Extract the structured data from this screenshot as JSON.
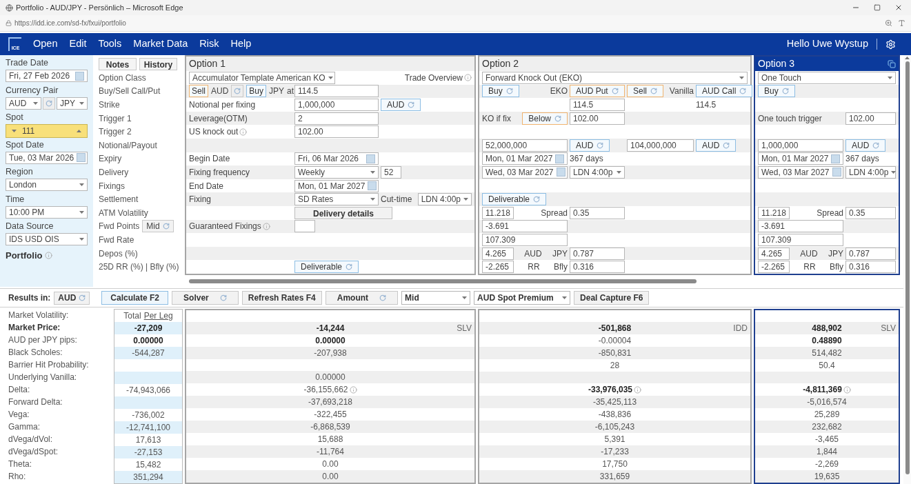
{
  "browser": {
    "title": "Portfolio - AUD/JPY - Persönlich – Microsoft Edge",
    "url": "https://idd.ice.com/sd-fx/fxui/portfolio"
  },
  "app": {
    "logo": "ICE",
    "menu": [
      "Open",
      "Edit",
      "Tools",
      "Market Data",
      "Risk",
      "Help"
    ],
    "greeting": "Hello Uwe Wystup"
  },
  "sidebar": {
    "fields": [
      {
        "label": "Trade Date",
        "kind": "date",
        "value": "Fri, 27 Feb 2026"
      },
      {
        "label": "Currency Pair",
        "kind": "pair",
        "base": "AUD",
        "quote": "JPY"
      },
      {
        "label": "Spot",
        "kind": "spot",
        "value": "111"
      },
      {
        "label": "Spot Date",
        "kind": "date",
        "value": "Tue, 03 Mar 2026"
      },
      {
        "label": "Region",
        "kind": "select",
        "value": "London"
      },
      {
        "label": "Time",
        "kind": "select",
        "value": "10:00 PM"
      },
      {
        "label": "Data Source",
        "kind": "select",
        "value": "IDS USD OIS"
      }
    ],
    "portfolio": "Portfolio"
  },
  "panel_buttons": [
    "Notes",
    "History"
  ],
  "row_labels": [
    {
      "text": "Option Class"
    },
    {
      "text": "Buy/Sell Call/Put"
    },
    {
      "text": "Strike"
    },
    {
      "text": "Trigger 1"
    },
    {
      "text": "Trigger 2"
    },
    {
      "text": "Notional/Payout"
    },
    {
      "text": "Expiry"
    },
    {
      "text": "Delivery"
    },
    {
      "text": "Fixings"
    },
    {
      "text": "Settlement"
    },
    {
      "text": "ATM Volatility"
    },
    {
      "text": "Fwd Points",
      "toggle": "Mid"
    },
    {
      "text": "Fwd Rate"
    },
    {
      "text": "Depos (%)"
    },
    {
      "text": "25D RR (%) | Bfly (%)"
    }
  ],
  "options": [
    {
      "title": "Option 1",
      "selected": false,
      "product": "Accumulator Template American KO",
      "overview": "Trade Overview",
      "rows": [
        {
          "left": [
            {
              "kind": "choice",
              "text": "Sell",
              "color": "#f0b36e"
            },
            {
              "kind": "text",
              "text": "AUD"
            },
            {
              "kind": "swap"
            },
            {
              "kind": "choice",
              "text": "Buy",
              "color": "#8cbde3"
            },
            {
              "kind": "text",
              "text": "JPY"
            },
            {
              "kind": "text",
              "text": "at"
            }
          ],
          "middle": [
            {
              "kind": "input",
              "text": "114.5"
            }
          ]
        },
        {
          "left": [
            {
              "kind": "text",
              "text": "Notional per fixing"
            }
          ],
          "middle": [
            {
              "kind": "input",
              "text": "1,000,000"
            }
          ],
          "right": [
            {
              "kind": "toggle",
              "text": "AUD",
              "color": "#8cbde3"
            }
          ]
        },
        {
          "left": [
            {
              "kind": "text",
              "text": "Leverage(OTM)"
            }
          ],
          "middle": [
            {
              "kind": "input",
              "text": "2"
            }
          ]
        },
        {
          "left": [
            {
              "kind": "text",
              "text": "US knock out",
              "info": true
            }
          ],
          "middle": [
            {
              "kind": "input",
              "text": "102.00"
            }
          ]
        },
        {},
        {
          "left": [
            {
              "kind": "text",
              "text": "Begin Date"
            }
          ],
          "middle": [
            {
              "kind": "date",
              "text": "Fri, 06 Mar 2026"
            }
          ]
        },
        {
          "left": [
            {
              "kind": "text",
              "text": "Fixing frequency"
            }
          ],
          "middle": [
            {
              "kind": "select",
              "text": "Weekly"
            }
          ],
          "right": [
            {
              "kind": "box",
              "text": "52"
            }
          ]
        },
        {
          "left": [
            {
              "kind": "text",
              "text": "End Date"
            }
          ],
          "middle": [
            {
              "kind": "date",
              "text": "Mon, 01 Mar 2027"
            }
          ]
        },
        {
          "left": [
            {
              "kind": "text",
              "text": "Fixing"
            }
          ],
          "middle": [
            {
              "kind": "select",
              "text": "SD Rates"
            }
          ],
          "right": [
            {
              "kind": "text",
              "text": "Cut-time"
            }
          ],
          "end": [
            {
              "kind": "select",
              "text": "LDN 4:00p"
            }
          ]
        },
        {
          "middle": [
            {
              "kind": "wide-button",
              "text": "Delivery details"
            }
          ]
        },
        {
          "left": [
            {
              "kind": "text",
              "text": "Guaranteed Fixings",
              "info": true
            }
          ],
          "middle": [
            {
              "kind": "box"
            }
          ]
        },
        {},
        {},
        {
          "middle": [
            {
              "kind": "toggle",
              "text": "Deliverable",
              "color": "#8cbde3"
            }
          ]
        }
      ]
    },
    {
      "title": "Option 2",
      "selected": false,
      "product": "Forward Knock Out (EKO)",
      "rows": [
        {
          "left": [
            {
              "kind": "toggle",
              "text": "Buy",
              "color": "#8cbde3"
            },
            {
              "kind": "text",
              "text": "EKO"
            }
          ],
          "middle": [
            {
              "kind": "toggle",
              "text": "AUD Put",
              "color": "#f0b36e"
            }
          ],
          "right": [
            {
              "kind": "toggle",
              "text": "Sell",
              "color": "#f0b36e"
            },
            {
              "kind": "text",
              "text": "Vanilla"
            }
          ],
          "end": [
            {
              "kind": "toggle",
              "text": "AUD Call",
              "color": "#8cbde3"
            }
          ]
        },
        {
          "middle": [
            {
              "kind": "input",
              "text": "114.5"
            }
          ],
          "end": [
            {
              "kind": "text",
              "text": "114.5"
            }
          ]
        },
        {
          "left": [
            {
              "kind": "text",
              "text": "KO if fix"
            },
            {
              "kind": "toggle",
              "text": "Below",
              "color": "#f0b36e"
            }
          ],
          "middle": [
            {
              "kind": "input",
              "text": "102.00"
            }
          ]
        },
        {},
        {
          "left": [
            {
              "kind": "input",
              "text": "52,000,000"
            }
          ],
          "middle": [
            {
              "kind": "toggle",
              "text": "AUD",
              "color": "#8cbde3"
            }
          ],
          "right": [
            {
              "kind": "input",
              "text": "104,000,000"
            }
          ],
          "end": [
            {
              "kind": "toggle",
              "text": "AUD",
              "color": "#8cbde3"
            }
          ]
        },
        {
          "left": [
            {
              "kind": "date",
              "text": "Mon, 01 Mar 2027"
            }
          ],
          "middle": [
            {
              "kind": "text",
              "text": "367 days"
            }
          ]
        },
        {
          "left": [
            {
              "kind": "date",
              "text": "Wed, 03 Mar 2027"
            }
          ],
          "middle": [
            {
              "kind": "select",
              "text": "LDN 4:00p"
            }
          ]
        },
        {},
        {
          "left": [
            {
              "kind": "toggle",
              "text": "Deliverable",
              "color": "#8cbde3"
            }
          ]
        },
        {
          "left": [
            {
              "kind": "short-input",
              "text": "11.218"
            },
            {
              "kind": "text",
              "text": "Spread"
            }
          ],
          "middle": [
            {
              "kind": "input",
              "text": "0.35"
            }
          ]
        },
        {
          "left": [
            {
              "kind": "input",
              "text": "-3.691"
            }
          ]
        },
        {
          "left": [
            {
              "kind": "input",
              "text": "107.309"
            }
          ]
        },
        {
          "left": [
            {
              "kind": "short-input",
              "text": "4.265"
            },
            {
              "kind": "text",
              "text": "AUD"
            },
            {
              "kind": "text",
              "text": "JPY"
            }
          ],
          "middle": [
            {
              "kind": "input",
              "text": "0.787"
            }
          ]
        },
        {
          "left": [
            {
              "kind": "short-input",
              "text": "-2.265"
            },
            {
              "kind": "text",
              "text": "RR"
            },
            {
              "kind": "text",
              "text": "Bfly"
            }
          ],
          "middle": [
            {
              "kind": "input",
              "text": "0.316"
            }
          ]
        }
      ]
    },
    {
      "title": "Option 3",
      "selected": true,
      "product": "One Touch",
      "rows": [
        {
          "left": [
            {
              "kind": "toggle",
              "text": "Buy",
              "color": "#8cbde3"
            }
          ]
        },
        {},
        {
          "left": [
            {
              "kind": "text",
              "text": "One touch trigger"
            }
          ],
          "middle": [
            {
              "kind": "input",
              "text": "102.00"
            }
          ]
        },
        {},
        {
          "left": [
            {
              "kind": "input",
              "text": "1,000,000"
            }
          ],
          "middle": [
            {
              "kind": "toggle",
              "text": "AUD",
              "color": "#8cbde3"
            }
          ]
        },
        {
          "left": [
            {
              "kind": "date",
              "text": "Mon, 01 Mar 2027"
            }
          ],
          "middle": [
            {
              "kind": "text",
              "text": "367 days"
            }
          ]
        },
        {
          "left": [
            {
              "kind": "date",
              "text": "Wed, 03 Mar 2027"
            }
          ],
          "middle": [
            {
              "kind": "select",
              "text": "LDN 4:00p"
            }
          ]
        },
        {},
        {},
        {
          "left": [
            {
              "kind": "short-input",
              "text": "11.218"
            },
            {
              "kind": "text",
              "text": "Spread"
            }
          ],
          "middle": [
            {
              "kind": "input",
              "text": "0.35"
            }
          ]
        },
        {
          "left": [
            {
              "kind": "input",
              "text": "-3.691"
            }
          ]
        },
        {
          "left": [
            {
              "kind": "input",
              "text": "107.309"
            }
          ]
        },
        {
          "left": [
            {
              "kind": "short-input",
              "text": "4.265"
            },
            {
              "kind": "text",
              "text": "AUD"
            },
            {
              "kind": "text",
              "text": "JPY"
            }
          ],
          "middle": [
            {
              "kind": "input",
              "text": "0.787"
            }
          ]
        },
        {
          "left": [
            {
              "kind": "short-input",
              "text": "-2.265"
            },
            {
              "kind": "text",
              "text": "RR"
            },
            {
              "kind": "text",
              "text": "Bfly"
            }
          ],
          "middle": [
            {
              "kind": "input",
              "text": "0.316"
            }
          ]
        }
      ]
    }
  ],
  "toolbar": {
    "label": "Results in:",
    "currency": "AUD",
    "controls": [
      {
        "kind": "primary",
        "text": "Calculate F2"
      },
      {
        "kind": "toggle",
        "text": "Solver"
      },
      {
        "kind": "button",
        "text": "Refresh Rates F4"
      },
      {
        "kind": "toggle",
        "text": "Amount"
      },
      {
        "kind": "select",
        "text": "Mid"
      },
      {
        "kind": "select",
        "text": "AUD Spot Premium"
      },
      {
        "kind": "button",
        "text": "Deal Capture F6"
      }
    ]
  },
  "results": {
    "labels": [
      {
        "text": "Market Volatility:",
        "bold": false
      },
      {
        "text": "Market Price:",
        "bold": true
      },
      {
        "text": "AUD per JPY pips:",
        "bold": false
      },
      {
        "text": "Black Scholes:",
        "bold": false
      },
      {
        "text": "Barrier Hit Probability:",
        "bold": false
      },
      {
        "text": "Underlying Vanilla:",
        "bold": false
      },
      {
        "text": "Delta:",
        "bold": false
      },
      {
        "text": "Forward Delta:",
        "bold": false
      },
      {
        "text": "Vega:",
        "bold": false
      },
      {
        "text": "Gamma:",
        "bold": false
      },
      {
        "text": "dVega/dVol:",
        "bold": false
      },
      {
        "text": "dVega/dSpot:",
        "bold": false
      },
      {
        "text": "Theta:",
        "bold": false
      },
      {
        "text": "Rho:",
        "bold": false
      }
    ],
    "total": {
      "title": "Total",
      "link": "Per Leg",
      "cells": [
        {
          "text": "-27,209",
          "bold": true
        },
        {
          "text": "0.00000",
          "bold": true
        },
        {
          "text": "-544,287",
          "bold": false
        },
        null,
        null,
        {
          "text": "-74,943,066",
          "bold": false
        },
        null,
        {
          "text": "-736,002",
          "bold": false
        },
        {
          "text": "-12,741,100",
          "bold": false
        },
        {
          "text": "17,613",
          "bold": false
        },
        {
          "text": "-27,153",
          "bold": false
        },
        {
          "text": "15,482",
          "bold": false
        },
        {
          "text": "351,294",
          "bold": false
        }
      ]
    },
    "legs": [
      {
        "model": "SLV",
        "cells": [
          {
            "text": "-14,244",
            "bold": true
          },
          {
            "text": "0.00000",
            "bold": true
          },
          {
            "text": "-207,938",
            "bold": false
          },
          null,
          {
            "text": "0.00000",
            "bold": false
          },
          {
            "text": "-36,155,662",
            "bold": false,
            "info": true
          },
          {
            "text": "-37,693,218",
            "bold": false
          },
          {
            "text": "-322,455",
            "bold": false
          },
          {
            "text": "-6,868,539",
            "bold": false
          },
          {
            "text": "15,688",
            "bold": false
          },
          {
            "text": "-11,764",
            "bold": false
          },
          {
            "text": "0.00",
            "bold": false
          },
          {
            "text": "0.00",
            "bold": false
          }
        ]
      },
      {
        "model": "IDD",
        "cells": [
          {
            "text": "-501,868",
            "bold": true
          },
          {
            "text": "-0.00004",
            "bold": false
          },
          {
            "text": "-850,831",
            "bold": false
          },
          {
            "text": "28",
            "bold": false
          },
          null,
          {
            "text": "-33,976,035",
            "bold": true,
            "info": true
          },
          {
            "text": "-35,425,113",
            "bold": false
          },
          {
            "text": "-438,836",
            "bold": false
          },
          {
            "text": "-6,105,243",
            "bold": false
          },
          {
            "text": "5,391",
            "bold": false
          },
          {
            "text": "-17,233",
            "bold": false
          },
          {
            "text": "17,750",
            "bold": false
          },
          {
            "text": "331,659",
            "bold": false
          }
        ]
      },
      {
        "model": "SLV",
        "cells": [
          {
            "text": "488,902",
            "bold": true
          },
          {
            "text": "0.48890",
            "bold": true
          },
          {
            "text": "514,482",
            "bold": false
          },
          {
            "text": "50.4",
            "bold": false
          },
          null,
          {
            "text": "-4,811,369",
            "bold": true,
            "info": true
          },
          {
            "text": "-5,016,574",
            "bold": false
          },
          {
            "text": "25,289",
            "bold": false
          },
          {
            "text": "232,682",
            "bold": false
          },
          {
            "text": "-3,465",
            "bold": false
          },
          {
            "text": "1,844",
            "bold": false
          },
          {
            "text": "-2,269",
            "bold": false
          },
          {
            "text": "19,635",
            "bold": false
          }
        ]
      }
    ]
  }
}
